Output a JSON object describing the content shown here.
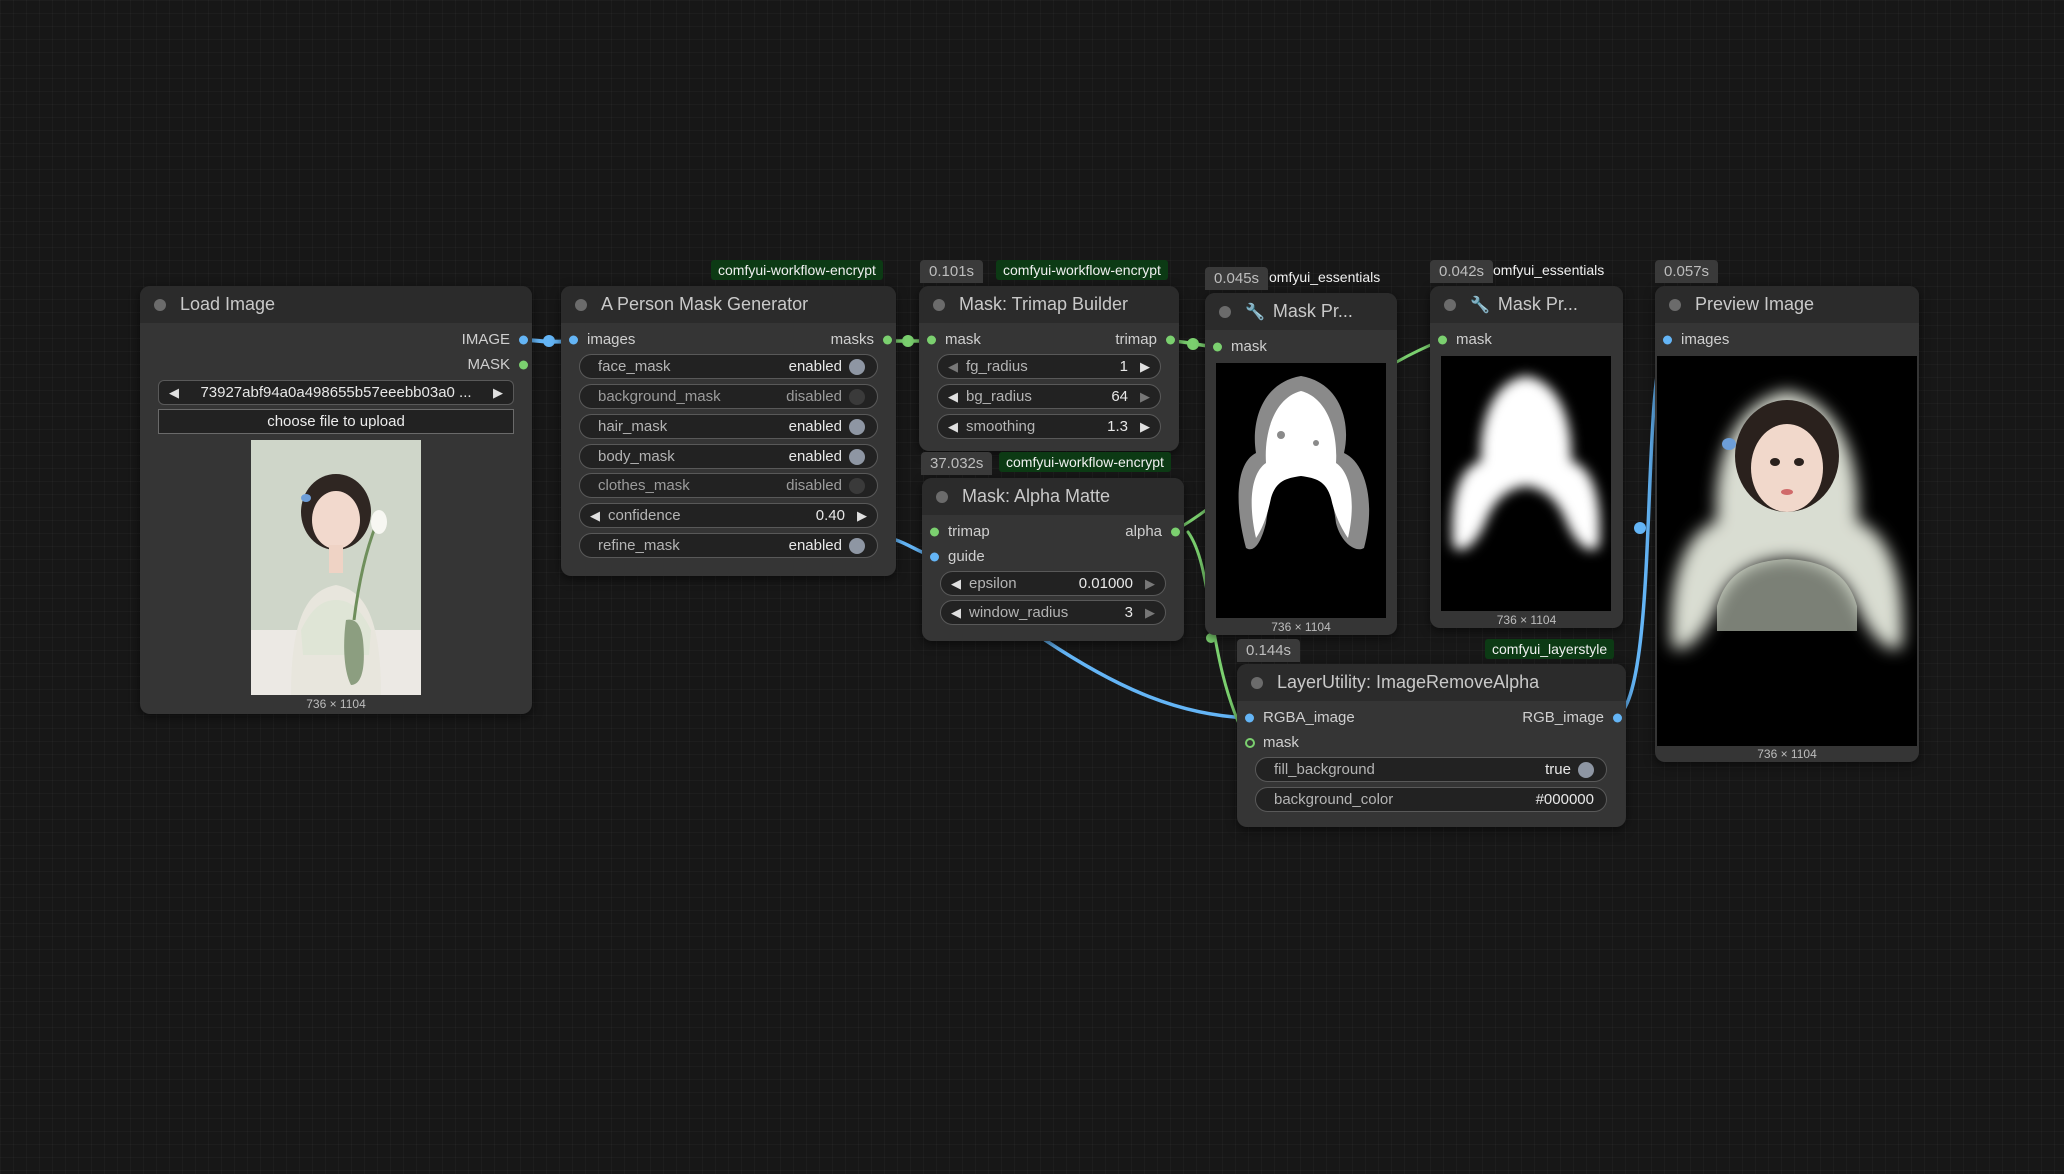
{
  "nodes": {
    "load_image": {
      "title": "Load Image",
      "outputs": [
        "IMAGE",
        "MASK"
      ],
      "file": "73927abf94a0a498655b57eeebb03a0 ...",
      "upload_label": "choose file to upload",
      "dims": "736 × 1104"
    },
    "person_mask": {
      "title": "A Person Mask Generator",
      "badge": "comfyui-workflow-encrypt",
      "input": "images",
      "output": "masks",
      "widgets": [
        {
          "label": "face_mask",
          "value": "enabled",
          "on": true
        },
        {
          "label": "background_mask",
          "value": "disabled",
          "on": false
        },
        {
          "label": "hair_mask",
          "value": "enabled",
          "on": true
        },
        {
          "label": "body_mask",
          "value": "enabled",
          "on": true
        },
        {
          "label": "clothes_mask",
          "value": "disabled",
          "on": false
        }
      ],
      "confidence": {
        "label": "confidence",
        "value": "0.40"
      },
      "refine_mask": {
        "label": "refine_mask",
        "value": "enabled",
        "on": true
      }
    },
    "trimap": {
      "title": "Mask: Trimap Builder",
      "timer": "0.101s",
      "badge": "comfyui-workflow-encrypt",
      "input": "mask",
      "output": "trimap",
      "widgets": [
        {
          "label": "fg_radius",
          "value": "1"
        },
        {
          "label": "bg_radius",
          "value": "64"
        },
        {
          "label": "smoothing",
          "value": "1.3"
        }
      ]
    },
    "alpha_matte": {
      "title": "Mask: Alpha Matte",
      "timer": "37.032s",
      "badge": "comfyui-workflow-encrypt",
      "inputs": [
        "trimap",
        "guide"
      ],
      "output": "alpha",
      "widgets": [
        {
          "label": "epsilon",
          "value": "0.01000"
        },
        {
          "label": "window_radius",
          "value": "3"
        }
      ]
    },
    "mask_preview_1": {
      "title": "Mask Pr...",
      "timer": "0.045s",
      "badge": "omfyui_essentials",
      "input": "mask",
      "dims": "736 × 1104"
    },
    "mask_preview_2": {
      "title": "Mask Pr...",
      "timer": "0.042s",
      "badge": "omfyui_essentials",
      "input": "mask",
      "dims": "736 × 1104"
    },
    "remove_alpha": {
      "title": "LayerUtility: ImageRemoveAlpha",
      "timer": "0.144s",
      "badge": "comfyui_layerstyle",
      "inputs": [
        "RGBA_image",
        "mask"
      ],
      "output": "RGB_image",
      "fill_background": {
        "label": "fill_background",
        "value": "true",
        "on": true
      },
      "background_color": {
        "label": "background_color",
        "value": "#000000"
      }
    },
    "preview_image": {
      "title": "Preview Image",
      "timer": "0.057s",
      "input": "images",
      "dims": "736 × 1104"
    }
  },
  "colors": {
    "canvas": "#171717",
    "node_body": "#353535",
    "node_header": "#2b2b2b",
    "image_link": "#64b5f6",
    "mask_link": "#7bd06f",
    "badge_bg": "#0c3a14"
  }
}
